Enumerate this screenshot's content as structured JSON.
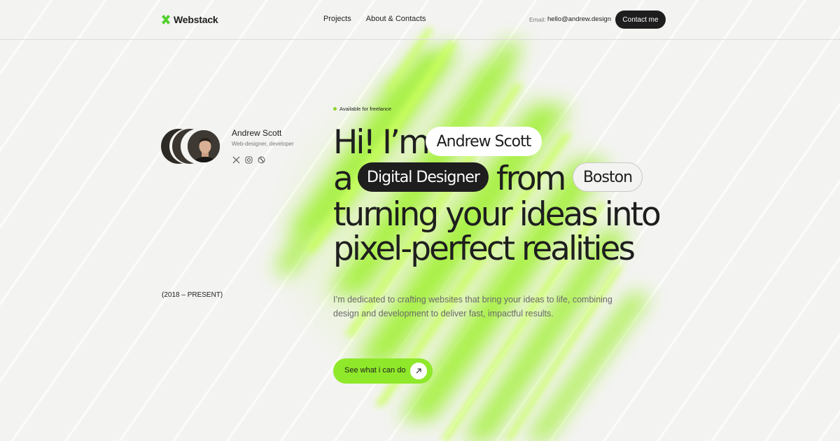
{
  "brand": {
    "name": "Webstack",
    "accent": "#8fe82a",
    "dark": "#1e1e1e"
  },
  "nav": {
    "items": [
      {
        "label": "Projects"
      },
      {
        "label": "About & Contacts"
      }
    ]
  },
  "header": {
    "email_label": "Email:",
    "email_value": "hello@andrew.design",
    "contact_label": "Contact me"
  },
  "profile": {
    "name": "Andrew Scott",
    "role": "Web-designer, developer",
    "socials": [
      "x-icon",
      "instagram-icon",
      "dribbble-icon"
    ]
  },
  "years": "(2018 – PRESENT)",
  "hero": {
    "availability": "Available for freelance",
    "line1": "Hi! I’m",
    "pill_name": "Andrew Scott",
    "line2_a": "a",
    "pill_role": "Digital Designer",
    "line2_from": "from",
    "pill_city": "Boston",
    "line3": "turning your ideas into",
    "line4": "pixel-perfect realities",
    "description": "I’m dedicated to crafting websites that bring your ideas to life, combining design and development to deliver fast, impactful results.",
    "cta_label": "See what i can do",
    "cta_icon": "arrow-up-right-icon"
  }
}
